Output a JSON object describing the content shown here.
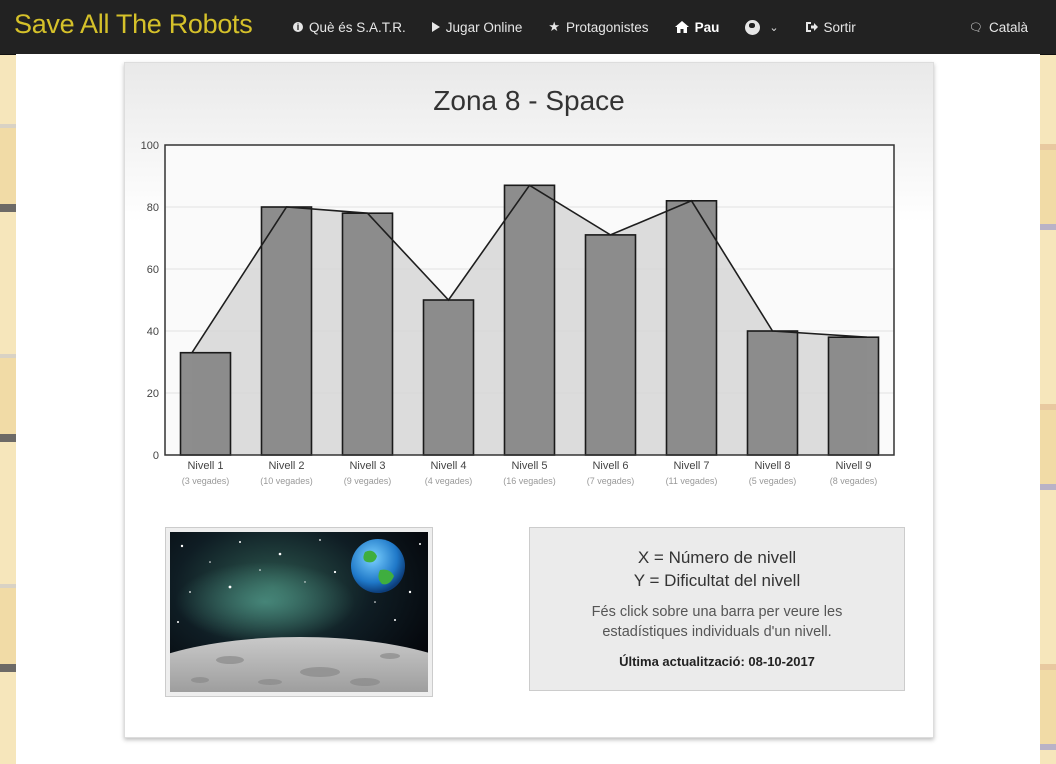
{
  "navbar": {
    "brand": "Save All The Robots",
    "items": [
      {
        "label": "Què és S.A.T.R.",
        "icon": "info-circle-icon"
      },
      {
        "label": "Jugar Online",
        "icon": "play-icon"
      },
      {
        "label": "Protagonistes",
        "icon": "star-icon"
      },
      {
        "label": "Pau",
        "icon": "home-icon"
      },
      {
        "label": "",
        "icon": "globe-icon"
      },
      {
        "label": "Sortir",
        "icon": "sign-out-icon"
      }
    ],
    "language": "Català",
    "language_icon": "speech-bubble-icon"
  },
  "panel": {
    "title": "Zona 8 - Space"
  },
  "chart_data": {
    "type": "bar",
    "categories": [
      "Nivell 1",
      "Nivell 2",
      "Nivell 3",
      "Nivell 4",
      "Nivell 5",
      "Nivell 6",
      "Nivell 7",
      "Nivell 8",
      "Nivell 9"
    ],
    "category_sublabels": [
      "(3 vegades)",
      "(10 vegades)",
      "(9 vegades)",
      "(4 vegades)",
      "(16 vegades)",
      "(7 vegades)",
      "(11 vegades)",
      "(5 vegades)",
      "(8 vegades)"
    ],
    "values": [
      33,
      80,
      78,
      50,
      87,
      71,
      82,
      40,
      38
    ],
    "overlay": "line-area",
    "xlabel": "",
    "ylabel": "",
    "ylim": [
      0,
      100
    ],
    "yticks": [
      0,
      20,
      40,
      60,
      80,
      100
    ],
    "grid": true,
    "colors": {
      "bar": "#878787",
      "area": "#d8d8d8",
      "line": "#1e1e1e"
    }
  },
  "info": {
    "x_label": "X = Número de nivell",
    "y_label": "Y = Dificultat del nivell",
    "description": "Fés click sobre una barra per veure les estadístiques individuals d'un nivell.",
    "last_update": "Última actualització: 08-10-2017"
  },
  "image": {
    "subject": "space-moon-earth-image"
  }
}
